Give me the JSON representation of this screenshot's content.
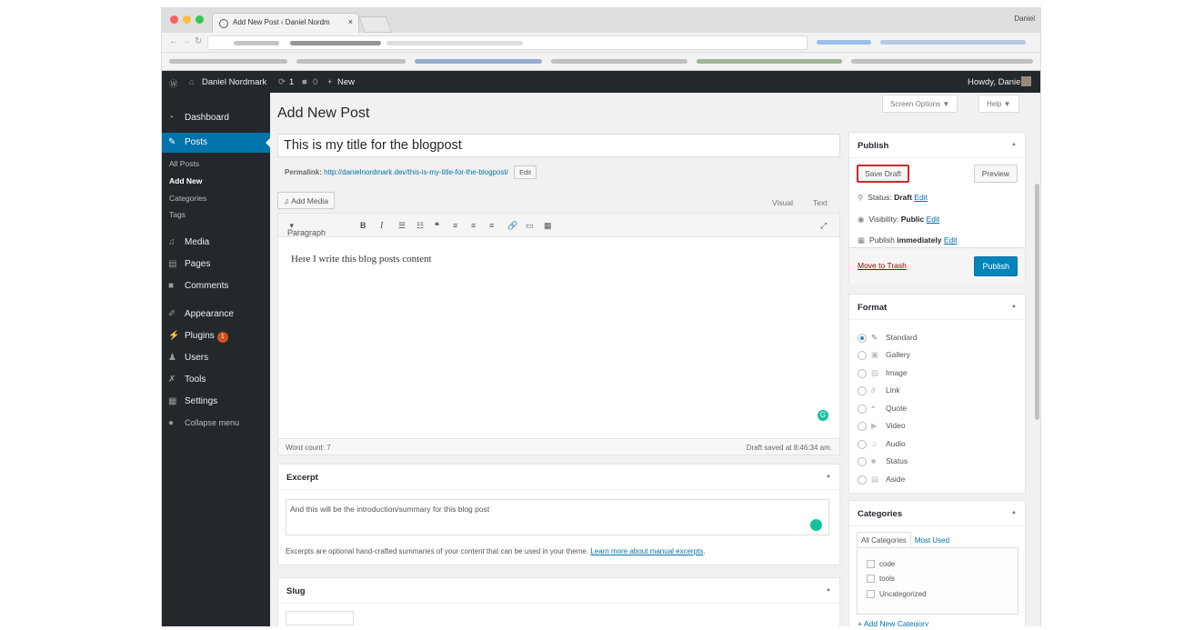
{
  "browser": {
    "tab_title": "Add New Post ‹ Daniel Nordm",
    "profile": "Daniel"
  },
  "adminbar": {
    "site_name": "Daniel Nordmark",
    "updates_count": "1",
    "comments_count": "0",
    "new_label": "New",
    "howdy": "Howdy, Daniel"
  },
  "sidebar": {
    "dashboard": "Dashboard",
    "posts": "Posts",
    "all_posts": "All Posts",
    "add_new": "Add New",
    "categories": "Categories",
    "tags": "Tags",
    "media": "Media",
    "pages": "Pages",
    "comments": "Comments",
    "appearance": "Appearance",
    "plugins": "Plugins",
    "plugins_badge": "1",
    "users": "Users",
    "tools": "Tools",
    "settings": "Settings",
    "collapse": "Collapse menu"
  },
  "header": {
    "screen_options": "Screen Options ▼",
    "help": "Help ▼",
    "page_title": "Add New Post"
  },
  "post": {
    "title": "This is my title for the blogpost",
    "permalink_label": "Permalink:",
    "permalink_url": "http://danielnordmark.dev/this-is-my-title-for-the-blogpost/",
    "permalink_edit": "Edit",
    "add_media": "Add Media",
    "tab_visual": "Visual",
    "tab_text": "Text",
    "format_select": "Paragraph",
    "content": "Here I write this blog posts content",
    "word_count": "Word count: 7",
    "draft_saved": "Draft saved at 8:46:34 am."
  },
  "excerpt": {
    "heading": "Excerpt",
    "value": "And this will be the introduction/summary for this blog post",
    "note": "Excerpts are optional hand-crafted summaries of your content that can be used in your theme.",
    "learn_more": "Learn more about manual excerpts",
    "note_end": "."
  },
  "slug": {
    "heading": "Slug"
  },
  "publish": {
    "heading": "Publish",
    "save_draft": "Save Draft",
    "preview": "Preview",
    "status_label": "Status:",
    "status_value": "Draft",
    "visibility_label": "Visibility:",
    "visibility_value": "Public",
    "publish_label": "Publish",
    "publish_value": "immediately",
    "edit": "Edit",
    "move_to_trash": "Move to Trash",
    "publish_button": "Publish"
  },
  "format": {
    "heading": "Format",
    "options": [
      "Standard",
      "Gallery",
      "Image",
      "Link",
      "Quote",
      "Video",
      "Audio",
      "Status",
      "Aside"
    ],
    "selected": "Standard"
  },
  "categories": {
    "heading": "Categories",
    "tab_all": "All Categories",
    "tab_most": "Most Used",
    "items": [
      "code",
      "tools",
      "Uncategorized"
    ],
    "add_new": "+ Add New Category"
  },
  "colors": {
    "admin_bar": "#23282d",
    "accent": "#0073aa",
    "publish_button": "#0085ba",
    "highlight": "#d9232d"
  }
}
